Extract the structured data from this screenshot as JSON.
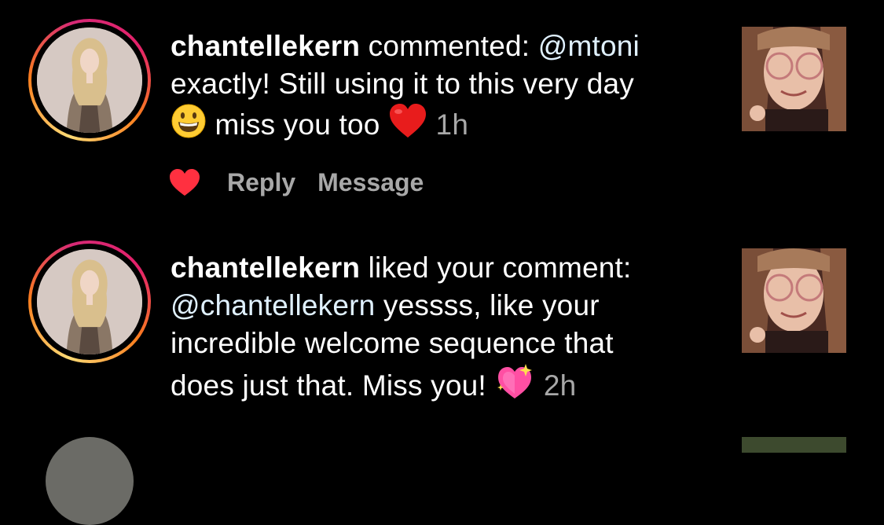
{
  "notifications": [
    {
      "username": "chantellekern",
      "action": " commented: ",
      "mention": "@mtoni",
      "body_line2": "exactly! Still using it to this very day",
      "body_line3": " miss you too ",
      "time": "1h",
      "emoji_1": "grinning-face-emoji",
      "emoji_2": "red-heart-emoji",
      "actions": {
        "like_icon": "heart-icon",
        "reply_label": "Reply",
        "message_label": "Message"
      }
    },
    {
      "username": "chantellekern",
      "action": " liked your comment:",
      "mention": "@chantellekern",
      "body_line2": " yessss, like your",
      "body_line3": "incredible welcome sequence that",
      "body_line4": "does just that. Miss you! ",
      "time": "2h",
      "emoji_1": "sparkling-heart-emoji"
    }
  ],
  "colors": {
    "background": "#000000",
    "text": "#ffffff",
    "secondary": "#a8a8a8",
    "mention": "#e0f1ff",
    "like": "#ff3040"
  }
}
